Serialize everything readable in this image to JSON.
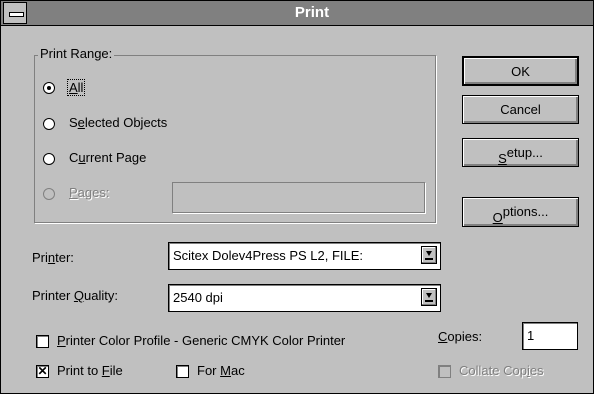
{
  "window": {
    "title": "Print"
  },
  "print_range": {
    "legend": "Print Range:",
    "options": [
      {
        "label": "All",
        "underline": "A",
        "selected": true,
        "enabled": true
      },
      {
        "label": "Selected Objects",
        "underline": "e",
        "selected": false,
        "enabled": true
      },
      {
        "label": "Current Page",
        "underline": "u",
        "selected": false,
        "enabled": true
      },
      {
        "label": "Pages:",
        "underline": "P",
        "selected": false,
        "enabled": false
      }
    ],
    "pages_value": ""
  },
  "buttons": {
    "ok": "OK",
    "cancel": "Cancel",
    "setup": "Setup...",
    "options": "Options..."
  },
  "printer": {
    "label": "Printer:",
    "value": "Scitex Dolev4Press PS L2, FILE:"
  },
  "quality": {
    "label": "Printer Quality:",
    "value": "2540 dpi"
  },
  "checkboxes": {
    "color_profile": {
      "label": "Printer Color Profile - Generic CMYK Color Printer",
      "checked": false,
      "enabled": true
    },
    "print_to_file": {
      "label": "Print to File",
      "checked": true,
      "enabled": true
    },
    "for_mac": {
      "label": "For Mac",
      "checked": false,
      "enabled": true
    },
    "collate": {
      "label": "Collate Copies",
      "checked": false,
      "enabled": false
    }
  },
  "copies": {
    "label": "Copies:",
    "value": "1"
  },
  "colors": {
    "face": "#c0c0c0",
    "title_bar": "#808080",
    "title_text": "#ffffff"
  }
}
